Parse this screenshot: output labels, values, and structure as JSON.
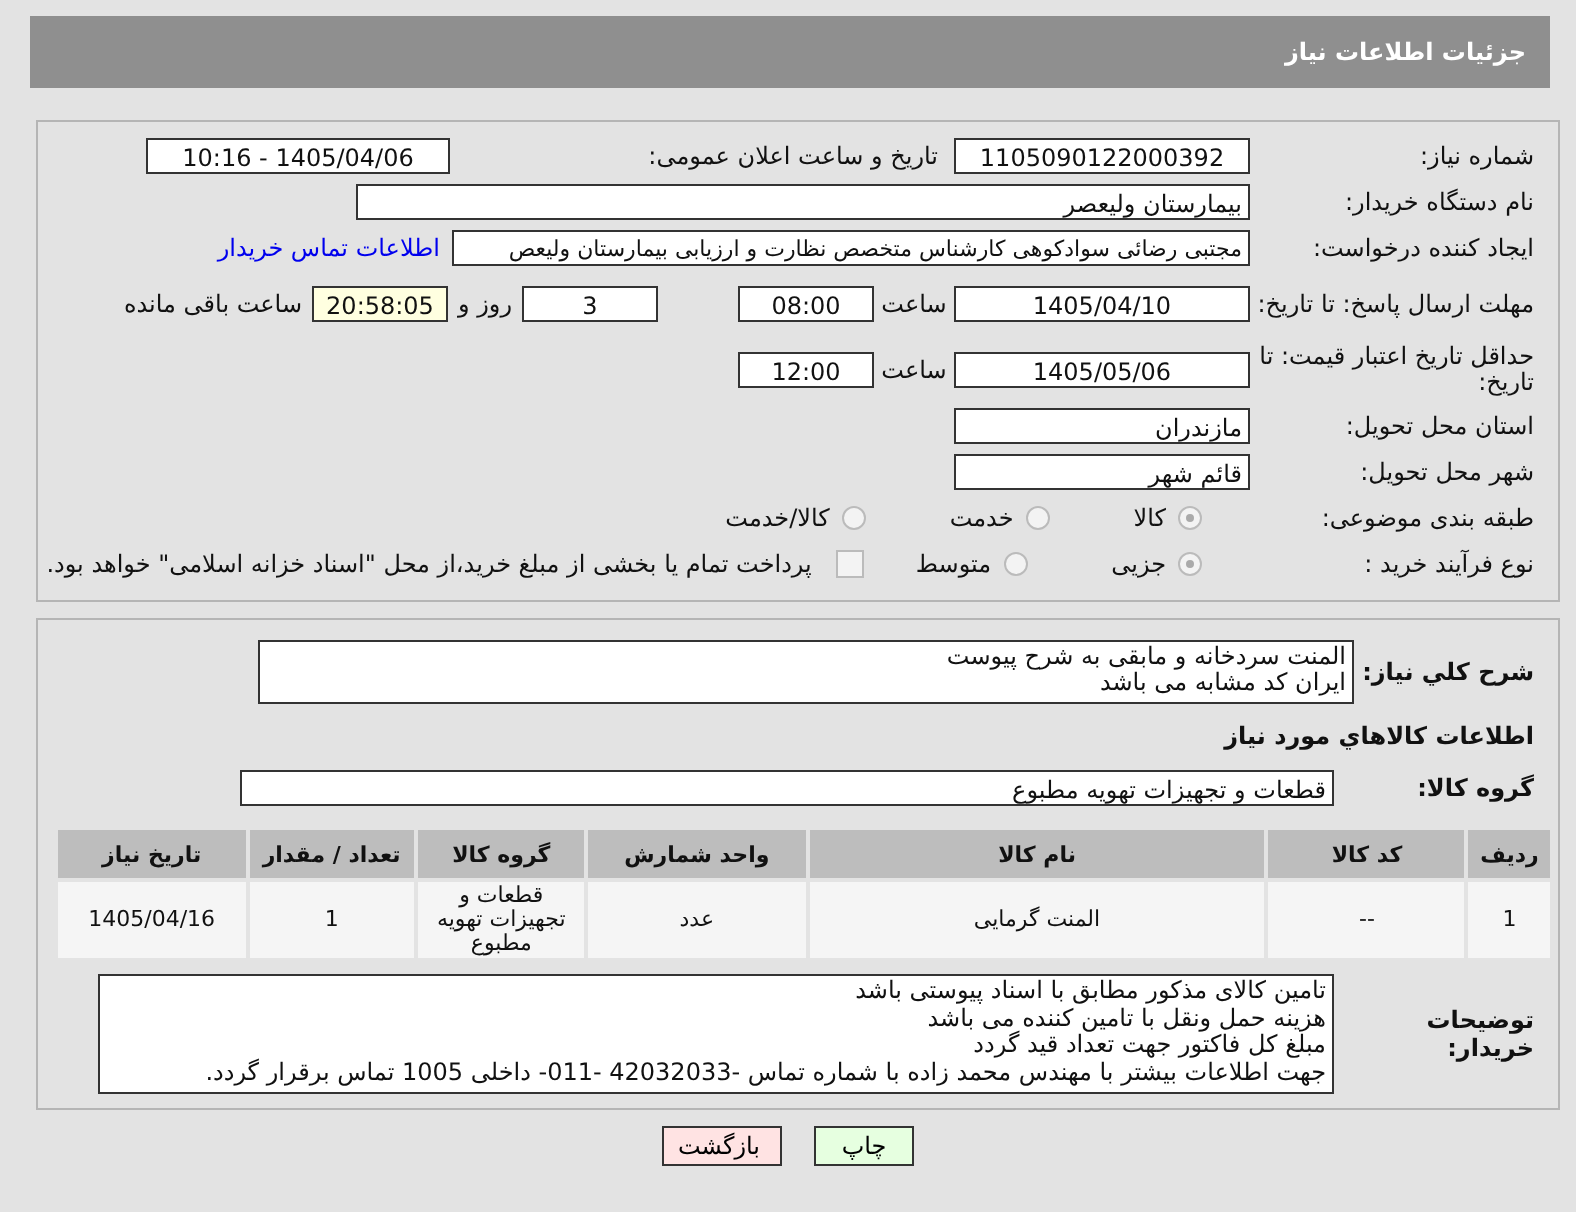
{
  "header": {
    "title": "جزئیات اطلاعات نیاز"
  },
  "details": {
    "need_number": {
      "label": "شماره نیاز:",
      "value": "1105090122000392"
    },
    "announce": {
      "label": "تاریخ و ساعت اعلان عمومی:",
      "value": "1405/04/06 - 10:16"
    },
    "buyer_org": {
      "label": "نام دستگاه خریدار:",
      "value": "بیمارستان ولیعصر"
    },
    "creator": {
      "label": "ایجاد کننده درخواست:",
      "value": "مجتبی رضائی سوادکوهی کارشناس متخصص نظارت و ارزیابی بیمارستان ولیعص",
      "link": "اطلاعات تماس خریدار"
    },
    "reply_deadline": {
      "label": "مهلت ارسال پاسخ: تا تاریخ:",
      "date": "1405/04/10",
      "time_label": "ساعت",
      "time": "08:00",
      "days": "3",
      "days_label": "روز و",
      "remaining": "20:58:05",
      "remaining_label": "ساعت باقی مانده"
    },
    "price_validity": {
      "label": "حداقل تاریخ اعتبار قیمت: تا تاریخ:",
      "date": "1405/05/06",
      "time_label": "ساعت",
      "time": "12:00"
    },
    "province": {
      "label": "استان محل تحویل:",
      "value": "مازندران"
    },
    "city": {
      "label": "شهر محل تحویل:",
      "value": "قائم شهر"
    },
    "category": {
      "label": "طبقه بندی موضوعی:",
      "options": [
        {
          "label": "کالا",
          "selected": true
        },
        {
          "label": "خدمت",
          "selected": false
        },
        {
          "label": "کالا/خدمت",
          "selected": false
        }
      ]
    },
    "process": {
      "label": "نوع فرآیند خرید :",
      "options": [
        {
          "label": "جزیی",
          "selected": true
        },
        {
          "label": "متوسط",
          "selected": false
        }
      ],
      "payment": {
        "checked": false,
        "label": "پرداخت تمام یا بخشی از مبلغ خرید،از محل \"اسناد خزانه اسلامی\" خواهد بود."
      }
    }
  },
  "need": {
    "description": {
      "label": "شرح کلي نیاز:",
      "lines": [
        "المنت سردخانه و مابقی به شرح پیوست",
        "ایران کد مشابه می باشد"
      ]
    },
    "goods_title": "اطلاعات کالاهاي مورد نیاز",
    "group": {
      "label": "گروه کالا:",
      "value": "قطعات و تجهیزات تهویه مطبوع"
    },
    "table": {
      "columns": [
        "ردیف",
        "کد کالا",
        "نام کالا",
        "واحد شمارش",
        "گروه کالا",
        "تعداد / مقدار",
        "تاریخ نیاز"
      ],
      "rows": [
        [
          "1",
          "--",
          "المنت گرمایی",
          "عدد",
          "قطعات و تجهیزات تهویه مطبوع",
          "1",
          "1405/04/16"
        ]
      ]
    },
    "notes": {
      "label": "توضیحات خریدار:",
      "lines": [
        "تامین کالای  مذکور مطابق با اسناد پیوستی باشد",
        "هزینه حمل ونقل با تامین کننده می باشد",
        "مبلغ کل  فاکتور جهت تعداد قید گردد",
        "جهت اطلاعات بیشتر با مهندس محمد زاده با شماره تماس -42032033 -011- داخلی 1005 تماس برقرار گردد."
      ]
    }
  },
  "buttons": [
    {
      "label": "چاپ",
      "kind": "print"
    },
    {
      "label": "بازگشت",
      "kind": "back"
    }
  ]
}
